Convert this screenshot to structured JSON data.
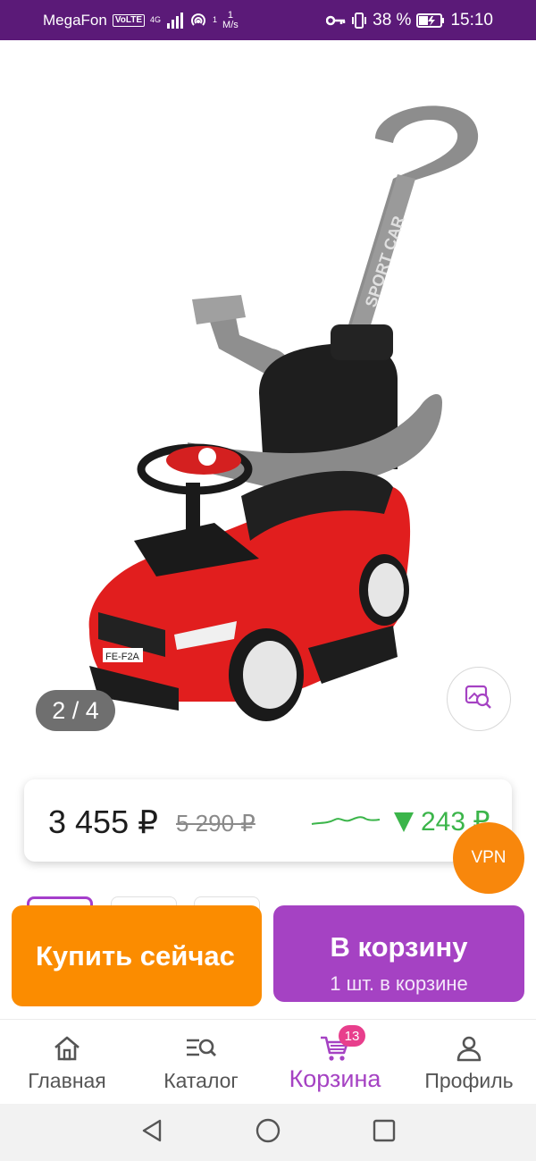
{
  "status_bar": {
    "carrier": "MegaFon",
    "volte": "VoLTE",
    "network": "4G",
    "hotspot_count": "1",
    "speed_value": "1",
    "speed_unit": "M/s",
    "battery": "38 %",
    "time": "15:10"
  },
  "gallery": {
    "counter": "2 / 4"
  },
  "price": {
    "current": "3 455 ₽",
    "old": "5 290 ₽",
    "difference": "243 ₽"
  },
  "vpn_label": "VPN",
  "actions": {
    "buy_now": "Купить сейчас",
    "add_to_cart": "В корзину",
    "cart_quantity": "1 шт. в корзине"
  },
  "bottom_nav": {
    "items": [
      {
        "label": "Главная",
        "icon": "home-icon"
      },
      {
        "label": "Каталог",
        "icon": "catalog-search-icon"
      },
      {
        "label": "Корзина",
        "icon": "cart-icon",
        "badge": "13",
        "active": true
      },
      {
        "label": "Профиль",
        "icon": "profile-icon"
      }
    ]
  },
  "colors": {
    "status_bar": "#5b1a78",
    "accent_purple": "#a542c3",
    "buy_orange": "#fb8c00",
    "price_down_green": "#3bb54a",
    "vpn_orange": "#f8870c"
  }
}
